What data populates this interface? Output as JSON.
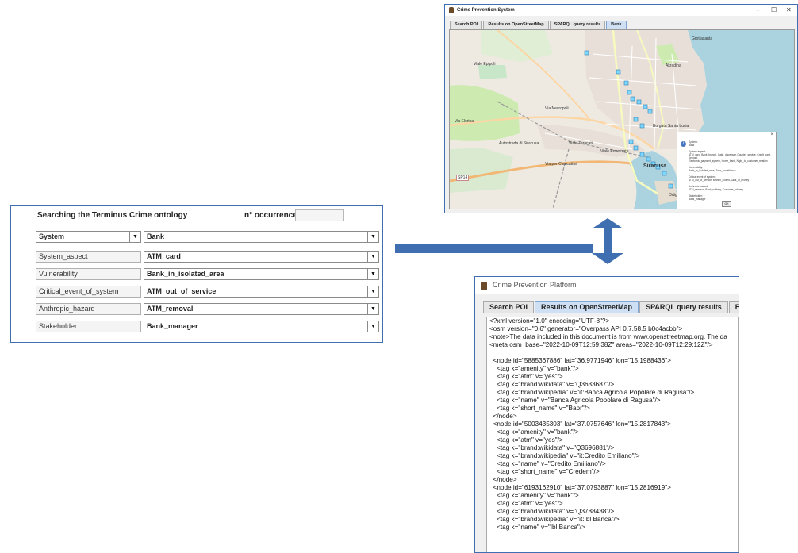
{
  "left_panel": {
    "header": "Searching the Terminus Crime ontology",
    "occurrences_label": "n° occurrences",
    "rows": [
      {
        "label": "System",
        "value": "Bank"
      },
      {
        "label": "System_aspect",
        "value": "ATM_card"
      },
      {
        "label": "Vulnerability",
        "value": "Bank_in_isolated_area"
      },
      {
        "label": "Critical_event_of_system",
        "value": "ATM_out_of_service"
      },
      {
        "label": "Anthropic_hazard",
        "value": "ATM_removal"
      },
      {
        "label": "Stakeholder",
        "value": "Bank_manager"
      }
    ]
  },
  "map_window": {
    "title": "Crime Prevention System",
    "controls": [
      "–",
      "☐",
      "✕"
    ],
    "tabs": [
      "Search POI",
      "Results on OpenStreetMap",
      "SPARQL query results",
      "Bank"
    ],
    "map_labels": [
      "Grottasanta",
      "Akradina",
      "Borgata Santa Lucia",
      "Siracusa",
      "Ortigia",
      "Viale Epipoli",
      "Via Elorina",
      "Via Necropoli",
      "Autostrada di Siracusa",
      "Viale Teracati",
      "SP14",
      "Via per Canicattini",
      "Viale Ermocrate"
    ],
    "popup": {
      "close": "×",
      "text": "System:\nBank\n\nSystem aspect:\nATM_card, Bank_branch, Cash_dispenser, Counter_service, Credit_card, Deposit,\nElectronic_payment_system, Home_bank, Night_to_customer_relation\n\nVulnerability:\nBank_in_isolated_area, Poor_surveillance\n\nCritical event of system:\nATM_out_of_service, Branch_closed, Lack_of_money\n\nAnthropic hazard:\nATM_removal, Bank_robbery, Customer_robbery\n\nStakeholder:\nBank_manager",
      "ok": "OK"
    }
  },
  "xml_window": {
    "title": "Crime Prevention Platform",
    "tabs": [
      "Search POI",
      "Results on OpenStreetMap",
      "SPARQL query results",
      "Bank"
    ],
    "lines": [
      "<?xml version=\"1.0\" encoding=\"UTF-8\"?>",
      "<osm version=\"0.6\" generator=\"Overpass API 0.7.58.5 b0c4acbb\">",
      "<note>The data included in this document is from www.openstreetmap.org. The da",
      "<meta osm_base=\"2022-10-09T12:59:38Z\" areas=\"2022-10-09T12:29:12Z\"/>",
      "",
      "  <node id=\"5885367886\" lat=\"36.9771946\" lon=\"15.1988436\">",
      "    <tag k=\"amenity\" v=\"bank\"/>",
      "    <tag k=\"atm\" v=\"yes\"/>",
      "    <tag k=\"brand:wikidata\" v=\"Q3633687\"/>",
      "    <tag k=\"brand:wikipedia\" v=\"it:Banca Agricola Popolare di Ragusa\"/>",
      "    <tag k=\"name\" v=\"Banca Agricola Popolare di Ragusa\"/>",
      "    <tag k=\"short_name\" v=\"Bapr\"/>",
      "  </node>",
      "  <node id=\"5003435303\" lat=\"37.0757646\" lon=\"15.2817843\">",
      "    <tag k=\"amenity\" v=\"bank\"/>",
      "    <tag k=\"atm\" v=\"yes\"/>",
      "    <tag k=\"brand:wikidata\" v=\"Q3696881\"/>",
      "    <tag k=\"brand:wikipedia\" v=\"it:Credito Emiliano\"/>",
      "    <tag k=\"name\" v=\"Credito Emiliano\"/>",
      "    <tag k=\"short_name\" v=\"Credem\"/>",
      "  </node>",
      "  <node id=\"6193162910\" lat=\"37.0793887\" lon=\"15.2816919\">",
      "    <tag k=\"amenity\" v=\"bank\"/>",
      "    <tag k=\"atm\" v=\"yes\"/>",
      "    <tag k=\"brand:wikidata\" v=\"Q3788438\"/>",
      "    <tag k=\"brand:wikipedia\" v=\"it:Ibl Banca\"/>",
      "    <tag k=\"name\" v=\"Ibl Banca\"/>"
    ]
  }
}
